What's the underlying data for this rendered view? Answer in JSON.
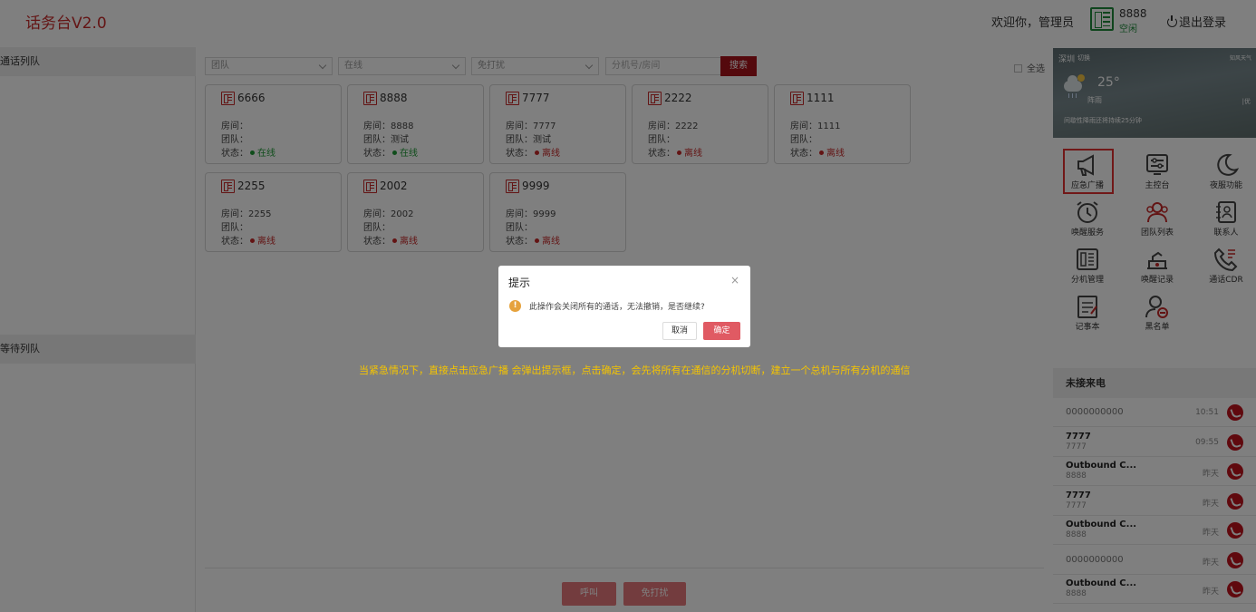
{
  "header": {
    "logo": "话务台V2.0",
    "welcome": "欢迎你，管理员",
    "extension": "8888",
    "extension_status": "空闲",
    "logout": "退出登录"
  },
  "left_panel": {
    "call_queue": "通话列队",
    "wait_queue": "等待列队"
  },
  "filters": {
    "team": "团队",
    "status": "在线",
    "dnd": "免打扰",
    "search_placeholder": "分机号/房间",
    "search_button": "搜索",
    "select_all": "全选"
  },
  "labels": {
    "room": "房间：",
    "team": "团队：",
    "status": "状态："
  },
  "extensions": [
    {
      "number": "6666",
      "room": "",
      "team": "",
      "status": "在线",
      "online": true
    },
    {
      "number": "8888",
      "room": "8888",
      "team": "测试",
      "status": "在线",
      "online": true
    },
    {
      "number": "7777",
      "room": "7777",
      "team": "测试",
      "status": "离线",
      "online": false
    },
    {
      "number": "2222",
      "room": "2222",
      "team": "",
      "status": "离线",
      "online": false
    },
    {
      "number": "1111",
      "room": "1111",
      "team": "",
      "status": "离线",
      "online": false
    },
    {
      "number": "2255",
      "room": "2255",
      "team": "",
      "status": "离线",
      "online": false
    },
    {
      "number": "2002",
      "room": "2002",
      "team": "",
      "status": "离线",
      "online": false
    },
    {
      "number": "9999",
      "room": "9999",
      "team": "",
      "status": "离线",
      "online": false
    }
  ],
  "bottom_buttons": {
    "call": "呼叫",
    "dnd": "免打扰"
  },
  "weather": {
    "city": "深圳",
    "switch": "切换",
    "brand": "知风天气",
    "temp": "25°",
    "desc": "阵雨",
    "side": "|优",
    "note": "间歇性降雨还将持续25分钟"
  },
  "functions": [
    {
      "label": "应急广播",
      "icon": "megaphone-icon"
    },
    {
      "label": "主控台",
      "icon": "console-icon"
    },
    {
      "label": "夜服功能",
      "icon": "moon-icon"
    },
    {
      "label": "唤醒服务",
      "icon": "alarm-clock-icon"
    },
    {
      "label": "团队列表",
      "icon": "team-icon"
    },
    {
      "label": "联系人",
      "icon": "contacts-icon"
    },
    {
      "label": "分机管理",
      "icon": "extension-icon"
    },
    {
      "label": "唤醒记录",
      "icon": "wake-record-icon"
    },
    {
      "label": "通话CDR",
      "icon": "call-cdr-icon"
    },
    {
      "label": "记事本",
      "icon": "notepad-icon"
    },
    {
      "label": "黑名单",
      "icon": "blacklist-icon"
    }
  ],
  "missed": {
    "title": "未接来电",
    "calls": [
      {
        "name": "0000000000",
        "sub": "",
        "time": "10:51"
      },
      {
        "name": "7777",
        "sub": "7777",
        "time": "09:55"
      },
      {
        "name": "Outbound C...",
        "sub": "8888",
        "time": "昨天"
      },
      {
        "name": "7777",
        "sub": "7777",
        "time": "昨天"
      },
      {
        "name": "Outbound C...",
        "sub": "8888",
        "time": "昨天"
      },
      {
        "name": "0000000000",
        "sub": "",
        "time": "昨天"
      },
      {
        "name": "Outbound C...",
        "sub": "8888",
        "time": "昨天"
      }
    ]
  },
  "dialog": {
    "title": "提示",
    "message": "此操作会关闭所有的通话，无法撤销，是否继续?",
    "cancel": "取消",
    "confirm": "确定"
  },
  "annotation": "当紧急情况下，直接点击应急广播 会弹出提示框，点击确定，会先将所有在通信的分机切断，建立一个总机与所有分机的通信"
}
